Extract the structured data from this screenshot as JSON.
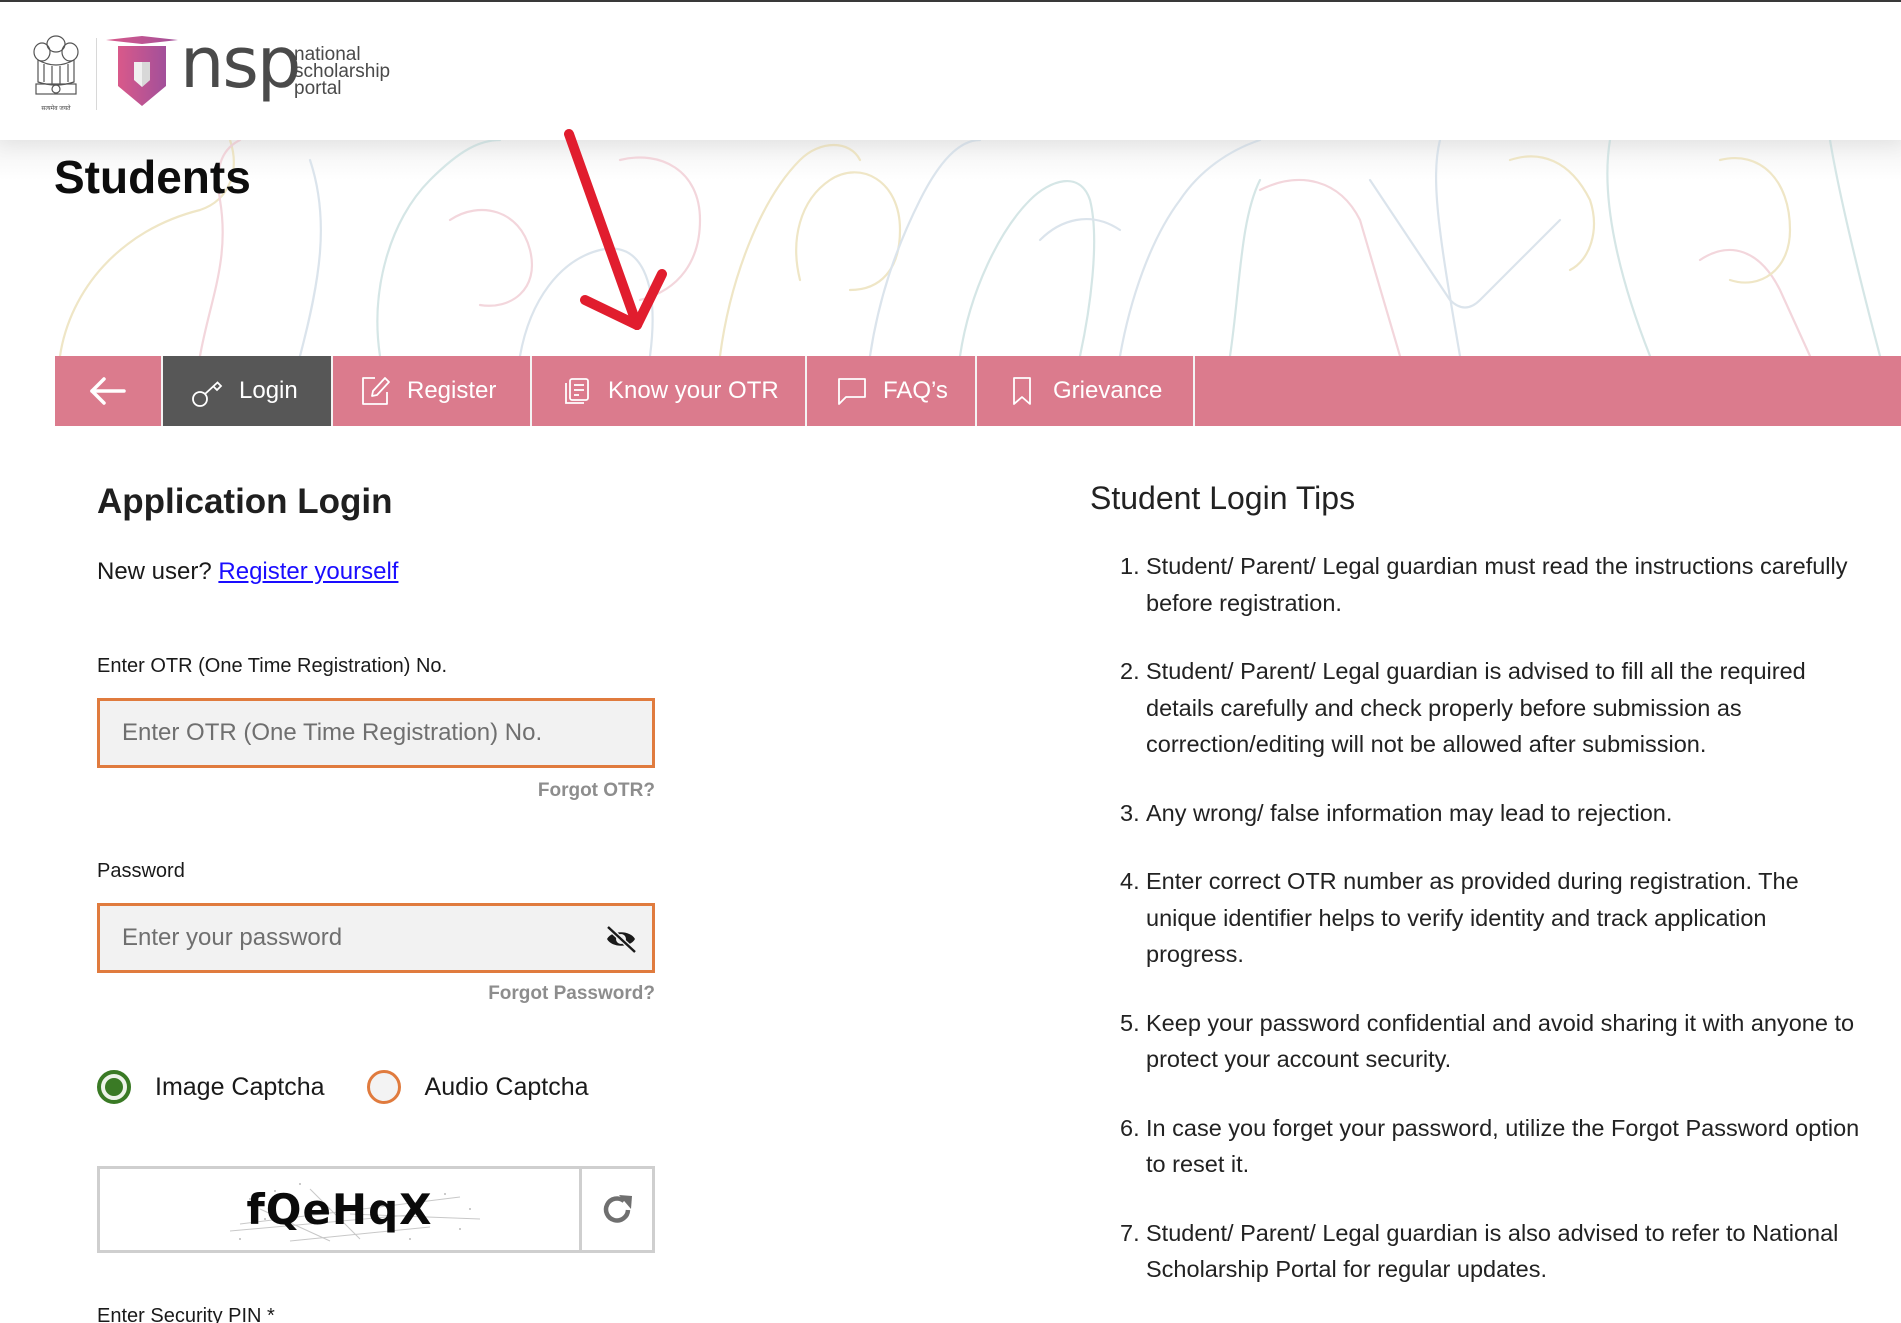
{
  "header": {
    "emblem_caption": "सत्यमेव जयते",
    "logo_word": "nsp",
    "logo_subtitle": [
      "national",
      "scholarship",
      "portal"
    ],
    "brand_color": "#db7b8d"
  },
  "page": {
    "title": "Students"
  },
  "nav": {
    "back_icon": "arrow-left-icon",
    "items": [
      {
        "label": "Login",
        "icon": "key-icon",
        "active": true
      },
      {
        "label": "Register",
        "icon": "edit-icon",
        "active": false
      },
      {
        "label": "Know your OTR",
        "icon": "document-list-icon",
        "active": false
      },
      {
        "label": "FAQ’s",
        "icon": "chat-bubble-icon",
        "active": false
      },
      {
        "label": "Grievance",
        "icon": "bookmark-icon",
        "active": false
      }
    ]
  },
  "login": {
    "title": "Application Login",
    "new_user_prefix": "New user? ",
    "register_link": "Register yourself",
    "otr_label": "Enter OTR (One Time Registration) No.",
    "otr_placeholder": "Enter OTR (One Time Registration) No.",
    "otr_value": "",
    "forgot_otr": "Forgot OTR?",
    "password_label": "Password",
    "password_placeholder": "Enter your password",
    "password_value": "",
    "password_toggle_icon": "eye-slash-icon",
    "forgot_password": "Forgot Password?",
    "captcha_options": [
      {
        "label": "Image Captcha",
        "selected": true
      },
      {
        "label": "Audio Captcha",
        "selected": false
      }
    ],
    "captcha_text": "fQeHqX",
    "refresh_icon": "refresh-icon",
    "security_pin_label": "Enter Security PIN *"
  },
  "tips": {
    "title": "Student Login Tips",
    "items": [
      {
        "num": "1.",
        "text": "Student/ Parent/ Legal guardian must read the instructions carefully before registration."
      },
      {
        "num": "2.",
        "text": "Student/ Parent/ Legal guardian is advised to fill all the required details carefully and check properly before submission as correction/editing will not be allowed after submission."
      },
      {
        "num": "3.",
        "text": "Any wrong/ false information may lead to rejection."
      },
      {
        "num": "4.",
        "text": "Enter correct OTR number as provided during registration. The unique identifier helps to verify identity and track application progress."
      },
      {
        "num": "5.",
        "text": "Keep your password confidential and avoid sharing it with anyone to protect your account security."
      },
      {
        "num": "6.",
        "text": "In case you forget your password, utilize the Forgot Password option to reset it."
      },
      {
        "num": "7.",
        "text": "Student/ Parent/ Legal guardian is also advised to refer to National Scholarship Portal for regular updates."
      }
    ]
  },
  "annotation": {
    "arrow_color": "#e11d2e"
  }
}
